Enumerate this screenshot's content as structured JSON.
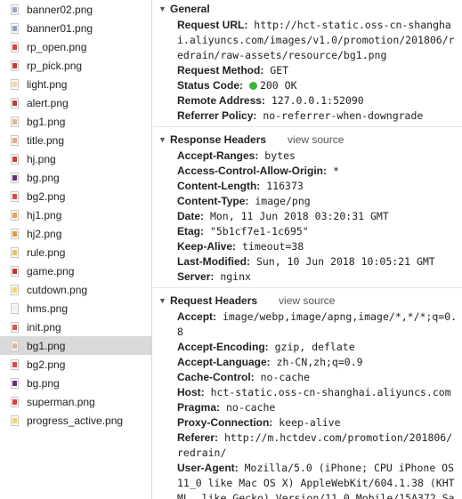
{
  "files": [
    {
      "name": "banner02.png",
      "thumb": "#9aa9c4"
    },
    {
      "name": "banner01.png",
      "thumb": "#8fa0bf"
    },
    {
      "name": "rp_open.png",
      "thumb": "#d9433a"
    },
    {
      "name": "rp_pick.png",
      "thumb": "#c93a33"
    },
    {
      "name": "light.png",
      "thumb": "#f2d7a0"
    },
    {
      "name": "alert.png",
      "thumb": "#b8433f"
    },
    {
      "name": "bg1.png",
      "thumb": "#e5b48a"
    },
    {
      "name": "title.png",
      "thumb": "#e9a77c"
    },
    {
      "name": "hj.png",
      "thumb": "#c8432f"
    },
    {
      "name": "bg.png",
      "thumb": "#6a2d7a"
    },
    {
      "name": "bg2.png",
      "thumb": "#d94a4a"
    },
    {
      "name": "hj1.png",
      "thumb": "#e8a54b"
    },
    {
      "name": "hj2.png",
      "thumb": "#e39a45"
    },
    {
      "name": "rule.png",
      "thumb": "#e6c26b"
    },
    {
      "name": "game.png",
      "thumb": "#c7372f"
    },
    {
      "name": "cutdown.png",
      "thumb": "#f3d46a"
    },
    {
      "name": "hms.png",
      "thumb": "#f2efe8"
    },
    {
      "name": "init.png",
      "thumb": "#d6584c"
    },
    {
      "name": "bg1.png",
      "thumb": "#e5b48a"
    },
    {
      "name": "bg2.png",
      "thumb": "#d94a4a"
    },
    {
      "name": "bg.png",
      "thumb": "#6a2d7a"
    },
    {
      "name": "superman.png",
      "thumb": "#d8433a"
    },
    {
      "name": "progress_active.png",
      "thumb": "#f1d36c"
    }
  ],
  "selected_index": 18,
  "general": {
    "title": "General",
    "rows": [
      {
        "key": "Request URL:",
        "value": "http://hct-static.oss-cn-shanghai.aliyuncs.com/images/v1.0/promotion/201806/redrain/raw-assets/resource/bg1.png"
      },
      {
        "key": "Request Method:",
        "value": "GET"
      },
      {
        "key": "Status Code:",
        "value": "200 OK",
        "status_dot": "#3bb83b"
      },
      {
        "key": "Remote Address:",
        "value": "127.0.0.1:52090"
      },
      {
        "key": "Referrer Policy:",
        "value": "no-referrer-when-downgrade"
      }
    ]
  },
  "response_headers": {
    "title": "Response Headers",
    "view_source": "view source",
    "rows": [
      {
        "key": "Accept-Ranges:",
        "value": "bytes"
      },
      {
        "key": "Access-Control-Allow-Origin:",
        "value": "*"
      },
      {
        "key": "Content-Length:",
        "value": "116373"
      },
      {
        "key": "Content-Type:",
        "value": "image/png"
      },
      {
        "key": "Date:",
        "value": "Mon, 11 Jun 2018 03:20:31 GMT"
      },
      {
        "key": "Etag:",
        "value": "\"5b1cf7e1-1c695\""
      },
      {
        "key": "Keep-Alive:",
        "value": "timeout=38"
      },
      {
        "key": "Last-Modified:",
        "value": "Sun, 10 Jun 2018 10:05:21 GMT"
      },
      {
        "key": "Server:",
        "value": "nginx"
      }
    ]
  },
  "request_headers": {
    "title": "Request Headers",
    "view_source": "view source",
    "rows": [
      {
        "key": "Accept:",
        "value": "image/webp,image/apng,image/*,*/*;q=0.8"
      },
      {
        "key": "Accept-Encoding:",
        "value": "gzip, deflate"
      },
      {
        "key": "Accept-Language:",
        "value": "zh-CN,zh;q=0.9"
      },
      {
        "key": "Cache-Control:",
        "value": "no-cache"
      },
      {
        "key": "Host:",
        "value": "hct-static.oss-cn-shanghai.aliyuncs.com"
      },
      {
        "key": "Pragma:",
        "value": "no-cache"
      },
      {
        "key": "Proxy-Connection:",
        "value": "keep-alive"
      },
      {
        "key": "Referer:",
        "value": "http://m.hctdev.com/promotion/201806/redrain/"
      },
      {
        "key": "User-Agent:",
        "value": "Mozilla/5.0 (iPhone; CPU iPhone OS 11_0 like Mac OS X) AppleWebKit/604.1.38 (KHTML, like Gecko) Version/11.0 Mobile/15A372 Safari/604.1"
      }
    ]
  }
}
